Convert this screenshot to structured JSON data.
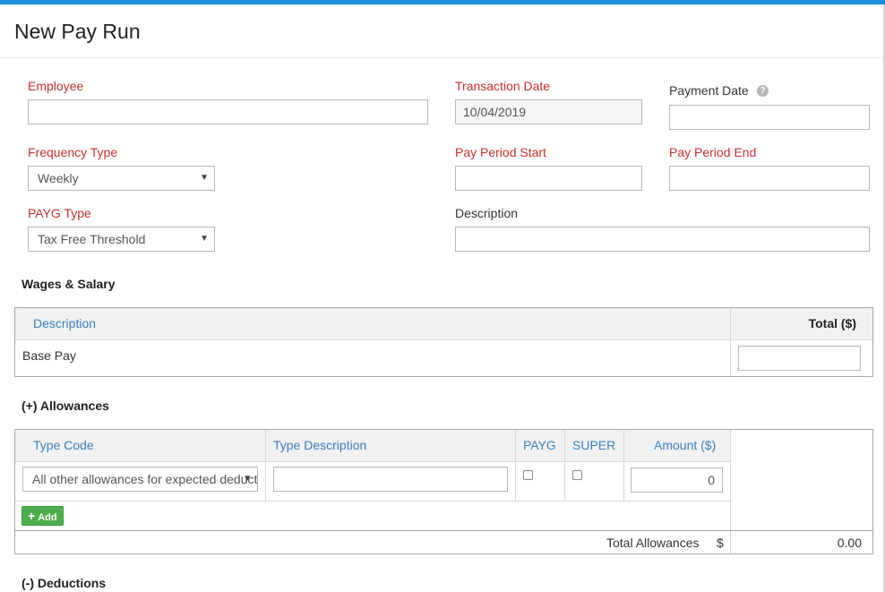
{
  "page": {
    "title": "New Pay Run"
  },
  "form": {
    "employee": {
      "label": "Employee",
      "value": ""
    },
    "transaction_date": {
      "label": "Transaction Date",
      "value": "10/04/2019"
    },
    "payment_date": {
      "label": "Payment Date",
      "value": "",
      "help_icon": "question-circle-icon",
      "help_glyph": "?"
    },
    "frequency_type": {
      "label": "Frequency Type",
      "value": "Weekly"
    },
    "pay_period_start": {
      "label": "Pay Period Start",
      "value": ""
    },
    "pay_period_end": {
      "label": "Pay Period End",
      "value": ""
    },
    "payg_type": {
      "label": "PAYG Type",
      "value": "Tax Free Threshold"
    },
    "description": {
      "label": "Description",
      "value": ""
    },
    "caret_glyph": "▼"
  },
  "wages": {
    "title": "Wages & Salary",
    "headers": {
      "description": "Description",
      "total": "Total ($)"
    },
    "rows": [
      {
        "description": "Base Pay",
        "total": ""
      }
    ]
  },
  "allowances": {
    "title": "(+) Allowances",
    "headers": {
      "type_code": "Type Code",
      "type_description": "Type Description",
      "payg": "PAYG",
      "super": "SUPER",
      "amount": "Amount ($)"
    },
    "rows": [
      {
        "type_code": "All other allowances for expected deductions",
        "type_description": "",
        "payg": false,
        "super": false,
        "amount": "0"
      }
    ],
    "add_label": "Add",
    "add_glyph": "+",
    "total_label": "Total Allowances",
    "currency_symbol": "$",
    "total_value": "0.00"
  },
  "deductions": {
    "title": "(-) Deductions"
  },
  "colors": {
    "accent_bar": "#1a8fdb",
    "required_label": "#c9302c",
    "header_link": "#3a7ec1",
    "add_button": "#4cae4c"
  }
}
